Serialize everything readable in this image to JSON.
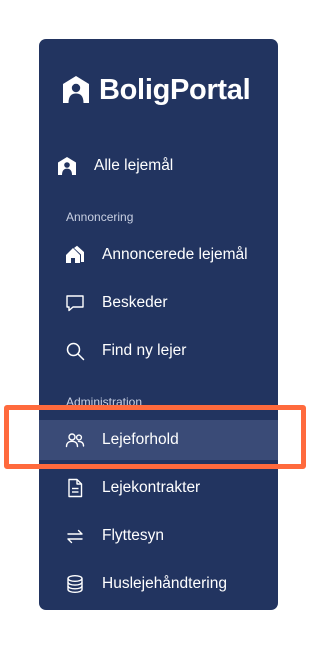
{
  "brand": {
    "name": "BoligPortal",
    "logo_icon": "house-person-icon"
  },
  "nav": {
    "all_rentals": {
      "label": "Alle lejemål",
      "icon": "house-person-icon"
    },
    "sections": [
      {
        "title": "Annoncering",
        "items": [
          {
            "label": "Annoncerede lejemål",
            "icon": "houses-icon"
          },
          {
            "label": "Beskeder",
            "icon": "chat-icon"
          },
          {
            "label": "Find ny lejer",
            "icon": "search-icon"
          }
        ]
      },
      {
        "title": "Administration",
        "items": [
          {
            "label": "Lejeforhold",
            "icon": "people-icon",
            "active": true
          },
          {
            "label": "Lejekontrakter",
            "icon": "document-icon"
          },
          {
            "label": "Flyttesyn",
            "icon": "arrows-swap-icon"
          },
          {
            "label": "Huslejehåndtering",
            "icon": "database-icon"
          }
        ]
      }
    ]
  },
  "colors": {
    "sidebar_bg": "#223460",
    "active_bg": "#3a4b77",
    "highlight": "#ff6a3d"
  }
}
